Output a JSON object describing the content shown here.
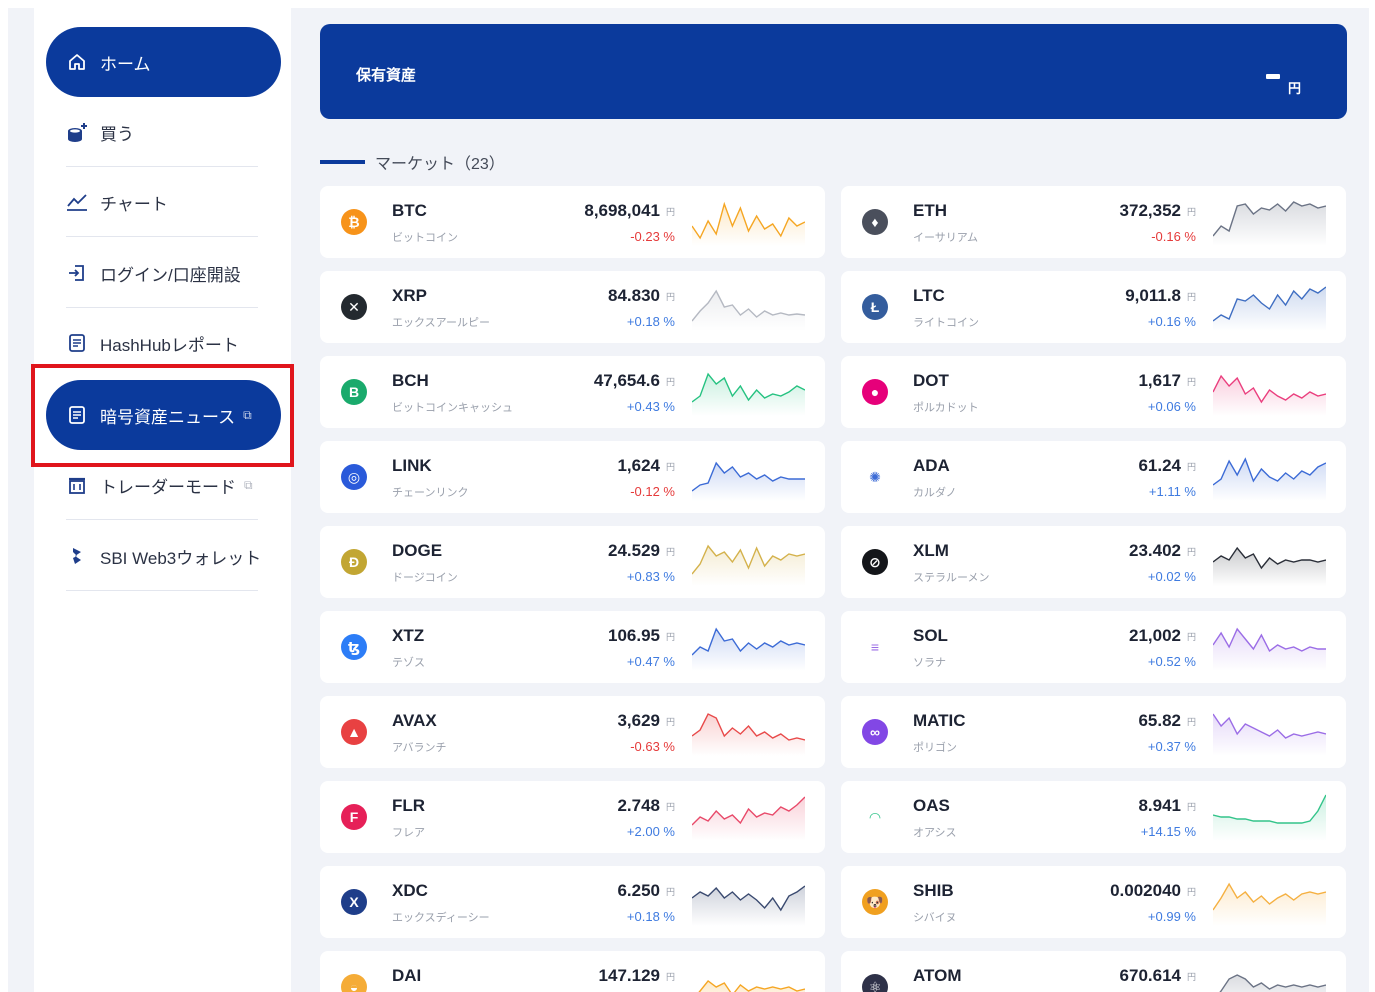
{
  "sidebar": {
    "items": [
      {
        "label": "ホーム",
        "icon": "home-icon",
        "active": true
      },
      {
        "label": "買う",
        "icon": "coins-icon",
        "active": false
      },
      {
        "label": "チャート",
        "icon": "chart-line-icon",
        "active": false
      },
      {
        "label": "ログイン/口座開設",
        "icon": "login-icon",
        "active": false
      },
      {
        "label": "HashHubレポート",
        "icon": "report-icon",
        "active": false
      },
      {
        "label": "暗号資産ニュース",
        "icon": "news-icon",
        "active": true,
        "external": true
      },
      {
        "label": "トレーダーモード",
        "icon": "trader-icon",
        "active": false,
        "external": true
      },
      {
        "label": "SBI Web3ウォレット",
        "icon": "wallet-icon",
        "active": false
      }
    ]
  },
  "asset": {
    "title": "保有資産",
    "value": "",
    "unit": "円"
  },
  "market": {
    "label": "マーケット（23）"
  },
  "yen_label": "円",
  "colors": {
    "brand": "#0b3a9c",
    "negative": "#e53b3b",
    "positive": "#3f7be0",
    "highlight": "#e0151c"
  },
  "coins": [
    {
      "symbol": "BTC",
      "name": "ビットコイン",
      "price": "8,698,041",
      "change": "-0.23 %",
      "dir": "neg",
      "icon_color": "#f7931a",
      "glyph": "₿",
      "spark_color": "#f5a623",
      "spark": [
        30,
        42,
        25,
        38,
        8,
        30,
        12,
        35,
        20,
        33,
        28,
        40,
        22,
        30,
        26
      ]
    },
    {
      "symbol": "ETH",
      "name": "イーサリアム",
      "price": "372,352",
      "change": "-0.16 %",
      "dir": "neg",
      "icon_color": "#4a4f5c",
      "glyph": "♦",
      "spark_color": "#6b7385",
      "spark": [
        40,
        30,
        35,
        10,
        8,
        18,
        12,
        14,
        8,
        15,
        6,
        10,
        8,
        12,
        10
      ]
    },
    {
      "symbol": "XRP",
      "name": "エックスアールピー",
      "price": "84.830",
      "change": "+0.18 %",
      "dir": "pos",
      "icon_color": "#23292f",
      "glyph": "✕",
      "spark_color": "#b5b9c2",
      "spark": [
        40,
        30,
        22,
        10,
        26,
        24,
        34,
        28,
        36,
        30,
        34,
        32,
        34,
        33,
        34
      ]
    },
    {
      "symbol": "LTC",
      "name": "ライトコイン",
      "price": "9,011.8",
      "change": "+0.16 %",
      "dir": "pos",
      "icon_color": "#345d9d",
      "glyph": "Ł",
      "spark_color": "#3f6ec2",
      "spark": [
        40,
        34,
        38,
        18,
        20,
        14,
        22,
        28,
        14,
        24,
        10,
        18,
        8,
        12,
        6
      ]
    },
    {
      "symbol": "BCH",
      "name": "ビットコインキャッシュ",
      "price": "47,654.6",
      "change": "+0.43 %",
      "dir": "pos",
      "icon_color": "#1aaa6c",
      "glyph": "B",
      "spark_color": "#26c281",
      "spark": [
        36,
        30,
        8,
        18,
        12,
        30,
        20,
        34,
        24,
        32,
        28,
        30,
        26,
        20,
        24
      ]
    },
    {
      "symbol": "DOT",
      "name": "ポルカドット",
      "price": "1,617",
      "change": "+0.06 %",
      "dir": "pos",
      "icon_color": "#e6007a",
      "glyph": "●",
      "spark_color": "#ea3f7e",
      "spark": [
        26,
        10,
        20,
        12,
        28,
        22,
        36,
        24,
        30,
        34,
        28,
        32,
        26,
        30,
        28
      ]
    },
    {
      "symbol": "LINK",
      "name": "チェーンリンク",
      "price": "1,624",
      "change": "-0.12 %",
      "dir": "neg",
      "icon_color": "#2a5ada",
      "glyph": "◎",
      "spark_color": "#3c6bd6",
      "spark": [
        40,
        34,
        32,
        12,
        22,
        16,
        26,
        22,
        28,
        24,
        30,
        26,
        28,
        28,
        28
      ]
    },
    {
      "symbol": "ADA",
      "name": "カルダノ",
      "price": "61.24",
      "change": "+1.11 %",
      "dir": "pos",
      "icon_color": "#ffffff",
      "glyph": "✺",
      "spark_color": "#3c6bd6",
      "spark": [
        34,
        28,
        10,
        24,
        8,
        30,
        18,
        26,
        30,
        22,
        28,
        20,
        24,
        16,
        12
      ]
    },
    {
      "symbol": "DOGE",
      "name": "ドージコイン",
      "price": "24.529",
      "change": "+0.83 %",
      "dir": "pos",
      "icon_color": "#c2a633",
      "glyph": "Ð",
      "spark_color": "#d4b24c",
      "spark": [
        38,
        28,
        10,
        20,
        16,
        26,
        14,
        32,
        12,
        30,
        20,
        24,
        18,
        20,
        18
      ]
    },
    {
      "symbol": "XLM",
      "name": "ステラルーメン",
      "price": "23.402",
      "change": "+0.02 %",
      "dir": "pos",
      "icon_color": "#14161a",
      "glyph": "⊘",
      "spark_color": "#2a2e38",
      "spark": [
        26,
        20,
        24,
        12,
        22,
        18,
        32,
        22,
        28,
        24,
        26,
        24,
        24,
        26,
        24
      ]
    },
    {
      "symbol": "XTZ",
      "name": "テゾス",
      "price": "106.95",
      "change": "+0.47 %",
      "dir": "pos",
      "icon_color": "#2c7df7",
      "glyph": "ꜩ",
      "spark_color": "#3c6bd6",
      "spark": [
        34,
        26,
        30,
        8,
        20,
        18,
        30,
        22,
        28,
        22,
        26,
        20,
        24,
        22,
        24
      ]
    },
    {
      "symbol": "SOL",
      "name": "ソラナ",
      "price": "21,002",
      "change": "+0.52 %",
      "dir": "pos",
      "icon_color": "#ffffff",
      "glyph": "≡",
      "spark_color": "#9b6de6",
      "spark": [
        24,
        12,
        26,
        8,
        18,
        28,
        14,
        30,
        24,
        28,
        26,
        30,
        26,
        28,
        28
      ]
    },
    {
      "symbol": "AVAX",
      "name": "アバランチ",
      "price": "3,629",
      "change": "-0.63 %",
      "dir": "neg",
      "icon_color": "#e84142",
      "glyph": "▲",
      "spark_color": "#e84a4a",
      "spark": [
        30,
        24,
        8,
        12,
        30,
        22,
        28,
        20,
        30,
        26,
        32,
        28,
        34,
        32,
        34
      ]
    },
    {
      "symbol": "MATIC",
      "name": "ポリゴン",
      "price": "65.82",
      "change": "+0.37 %",
      "dir": "pos",
      "icon_color": "#8247e5",
      "glyph": "∞",
      "spark_color": "#9b6de6",
      "spark": [
        8,
        20,
        12,
        28,
        18,
        22,
        26,
        30,
        24,
        32,
        28,
        30,
        28,
        26,
        28
      ]
    },
    {
      "symbol": "FLR",
      "name": "フレア",
      "price": "2.748",
      "change": "+2.00 %",
      "dir": "pos",
      "icon_color": "#e62058",
      "glyph": "F",
      "spark_color": "#e84a6a",
      "spark": [
        34,
        26,
        30,
        20,
        28,
        24,
        32,
        18,
        26,
        22,
        24,
        16,
        20,
        14,
        6
      ]
    },
    {
      "symbol": "OAS",
      "name": "オアシス",
      "price": "8.941",
      "change": "+14.15 %",
      "dir": "pos",
      "icon_color": "#ffffff",
      "glyph": "◠",
      "spark_color": "#33c48a",
      "spark": [
        24,
        26,
        26,
        28,
        28,
        30,
        30,
        30,
        32,
        32,
        32,
        32,
        30,
        20,
        4
      ]
    },
    {
      "symbol": "XDC",
      "name": "エックスディーシー",
      "price": "6.250",
      "change": "+0.18 %",
      "dir": "pos",
      "icon_color": "#1f3e8a",
      "glyph": "X",
      "spark_color": "#3a4a70",
      "spark": [
        22,
        16,
        20,
        12,
        22,
        16,
        24,
        18,
        24,
        32,
        22,
        34,
        20,
        16,
        10
      ]
    },
    {
      "symbol": "SHIB",
      "name": "シバイヌ",
      "price": "0.002040",
      "change": "+0.99 %",
      "dir": "pos",
      "icon_color": "#f0a020",
      "glyph": "🐶",
      "spark_color": "#f5b041",
      "spark": [
        34,
        22,
        8,
        22,
        16,
        26,
        20,
        28,
        22,
        18,
        24,
        18,
        16,
        18,
        16
      ]
    },
    {
      "symbol": "DAI",
      "name": "",
      "price": "147.129",
      "change": "",
      "dir": "pos",
      "icon_color": "#f5ac37",
      "glyph": "◒",
      "spark_color": "#f5a623",
      "spark": [
        40,
        30,
        20,
        26,
        22,
        34,
        24,
        30,
        26,
        28,
        26,
        28,
        26,
        30,
        28
      ]
    },
    {
      "symbol": "ATOM",
      "name": "",
      "price": "670.614",
      "change": "",
      "dir": "pos",
      "icon_color": "#2e3148",
      "glyph": "⚛",
      "spark_color": "#6b7385",
      "spark": [
        40,
        30,
        18,
        14,
        18,
        26,
        22,
        28,
        24,
        26,
        24,
        26,
        24,
        26,
        24
      ]
    }
  ]
}
